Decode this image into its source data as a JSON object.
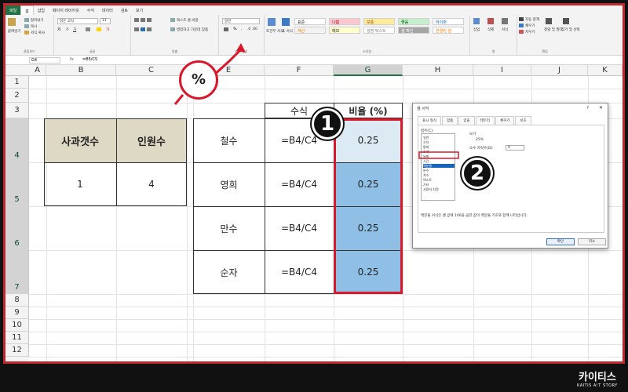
{
  "ribbon": {
    "tabs": [
      "파일",
      "홈",
      "삽입",
      "페이지 레이아웃",
      "수식",
      "데이터",
      "검토",
      "보기"
    ],
    "clipboard": {
      "paste": "붙여넣기",
      "cut": "잘라내기",
      "copy": "복사",
      "format_painter": "서식 복사",
      "label": "클립보드"
    },
    "font": {
      "name": "맑은 고딕",
      "size": "11",
      "label": "글꼴"
    },
    "alignment": {
      "wrap": "텍스트 줄 바꿈",
      "merge": "병합하고 가운데 맞춤",
      "label": "맞춤"
    },
    "number": {
      "format": "일반",
      "label": "표시 형식"
    },
    "styles": {
      "items": [
        {
          "label": "표준",
          "bg": "#ffffff",
          "color": "#222222"
        },
        {
          "label": "나쁨",
          "bg": "#ffc7ce",
          "color": "#9c0006"
        },
        {
          "label": "보통",
          "bg": "#ffeb9c",
          "color": "#9c5700"
        },
        {
          "label": "좋음",
          "bg": "#c6efce",
          "color": "#006100"
        },
        {
          "label": "하이퍼",
          "bg": "#ffffff",
          "color": "#0563c1"
        },
        {
          "label": "계산",
          "bg": "#f2f2f2",
          "color": "#fa7d00"
        },
        {
          "label": "메모",
          "bg": "#ffffcc",
          "color": "#222222"
        },
        {
          "label": "설명 텍스트",
          "bg": "#ffffff",
          "color": "#7f7f7f"
        },
        {
          "label": "셀 확인",
          "bg": "#a5a5a5",
          "color": "#ffffff"
        },
        {
          "label": "연결된 셀",
          "bg": "#ffffff",
          "color": "#fa7d00"
        }
      ],
      "conditional": "조건부 서식",
      "table": "표 서식",
      "label": "스타일"
    },
    "cells": {
      "insert": "삽입",
      "delete": "삭제",
      "format": "서식",
      "label": "셀"
    },
    "editing": {
      "autosum": "자동 합계",
      "fill": "채우기",
      "clear": "지우기",
      "sort": "정렬 및 필터",
      "find": "찾기 및 선택",
      "label": "편집"
    }
  },
  "formula_bar": {
    "name_box": "G4",
    "fx": "fx",
    "formula": "=B5/C5"
  },
  "columns": [
    "A",
    "B",
    "C",
    "D",
    "E",
    "F",
    "G",
    "H",
    "I",
    "J",
    "K"
  ],
  "rows": [
    "1",
    "2",
    "3",
    "4",
    "5",
    "6",
    "7",
    "8",
    "9",
    "10",
    "11",
    "12"
  ],
  "left_table": {
    "headers": [
      "사과갯수",
      "인원수"
    ],
    "values": [
      "1",
      "4"
    ],
    "header_bg": "#ddd9c4"
  },
  "main_table": {
    "headers": [
      "수식",
      "비율 (%)"
    ],
    "rows": [
      {
        "name": "철수",
        "formula": "=B4/C4",
        "value": "0.25"
      },
      {
        "name": "영희",
        "formula": "=B4/C4",
        "value": "0.25"
      },
      {
        "name": "만수",
        "formula": "=B4/C4",
        "value": "0.25"
      },
      {
        "name": "순자",
        "formula": "=B4/C4",
        "value": "0.25"
      }
    ],
    "selected_bg": "#8fbfe4",
    "active_bg": "#dceaf3",
    "highlight": "#d9182b"
  },
  "dialog": {
    "title": "셀 서식",
    "help": "?",
    "close": "✕",
    "tabs": [
      "표시 형식",
      "맞춤",
      "글꼴",
      "테두리",
      "채우기",
      "보호"
    ],
    "category_label": "범주(C):",
    "categories": [
      "일반",
      "숫자",
      "통화",
      "회계",
      "날짜",
      "시간",
      "백분율",
      "분수",
      "지수",
      "텍스트",
      "기타",
      "사용자 지정"
    ],
    "selected_category": "백분율",
    "sample_label": "보기",
    "sample_value": "25%",
    "decimal_label": "소수 자릿수(D):",
    "decimal_value": "0",
    "description": "백분율 서식은 셀 값에 100을 곱한 값이 백분율 기호와 함께 나타납니다.",
    "ok": "확인",
    "cancel": "취소"
  },
  "callouts": {
    "pct": "%",
    "step1": "1",
    "step2": "2"
  },
  "logo": {
    "main": "카이티스",
    "sub": "KAITIS A!T STORY"
  }
}
